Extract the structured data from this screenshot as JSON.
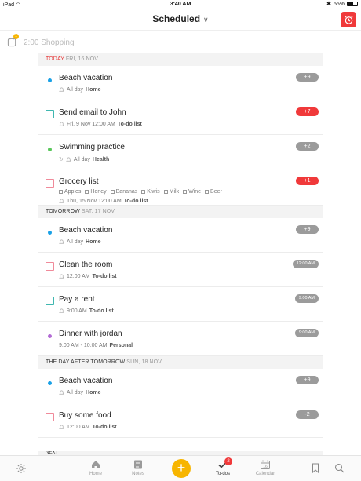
{
  "status": {
    "device": "iPad",
    "time": "3:40 AM",
    "battery": "55%",
    "battery_level": 0.55
  },
  "header": {
    "title": "Scheduled"
  },
  "reminder": {
    "text": "2:00 Shopping",
    "badge": "1"
  },
  "sections": [
    {
      "label": "TODAY",
      "date": "FRI, 16 NOV"
    },
    {
      "label": "TOMORROW",
      "date": "SAT, 17 NOV"
    },
    {
      "label": "THE DAY AFTER TOMORROW",
      "date": "SUN, 18 NOV"
    },
    {
      "label": "NEXT"
    }
  ],
  "items": [
    {
      "title": "Beach vacation",
      "time": "All day",
      "list": "Home",
      "pill": "+9",
      "kind": "dot",
      "color": "#1aa1e6"
    },
    {
      "title": "Send email to John",
      "time": "Fri, 9 Nov 12:00 AM",
      "list": "To-do list",
      "pill": "+7",
      "pill_red": true,
      "kind": "box",
      "color": "#3fb7b0"
    },
    {
      "title": "Swimming practice",
      "time": "All day",
      "list": "Health",
      "pill": "+2",
      "kind": "dot",
      "color": "#58c75a"
    },
    {
      "title": "Grocery list",
      "subtasks": [
        "Apples",
        "Honey",
        "Bananas",
        "Kiwis",
        "Milk",
        "Wine",
        "Beer"
      ],
      "time": "Thu, 15 Nov 12:00 AM",
      "list": "To-do list",
      "pill": "+1",
      "pill_red": true,
      "kind": "box",
      "color": "#f08a9a"
    },
    {
      "title": "Beach vacation",
      "time": "All day",
      "list": "Home",
      "pill": "+9",
      "kind": "dot",
      "color": "#1aa1e6"
    },
    {
      "title": "Clean the room",
      "time": "12:00 AM",
      "list": "To-do list",
      "pill": "12:00 AM",
      "kind": "box",
      "color": "#f08a9a"
    },
    {
      "title": "Pay a rent",
      "time": "9:00 AM",
      "list": "To-do list",
      "pill": "9:00 AM",
      "kind": "box",
      "color": "#3fb7b0"
    },
    {
      "title": "Dinner with jordan",
      "time": "9:00 AM - 10:00 AM",
      "list": "Personal",
      "pill": "9:00 AM",
      "kind": "dot",
      "color": "#b36bd4"
    },
    {
      "title": "Beach vacation",
      "time": "All day",
      "list": "Home",
      "pill": "+9",
      "kind": "dot",
      "color": "#1aa1e6"
    },
    {
      "title": "Buy some food",
      "time": "12:00 AM",
      "list": "To-do list",
      "pill": "-2",
      "kind": "box",
      "color": "#f08a9a"
    }
  ],
  "tabs": {
    "home": "Home",
    "notes": "Notes",
    "todos": "To-dos",
    "todos_badge": "2",
    "calendar": "Calendar"
  },
  "colors": {
    "accent": "#f0393a",
    "fab": "#f7b500"
  }
}
